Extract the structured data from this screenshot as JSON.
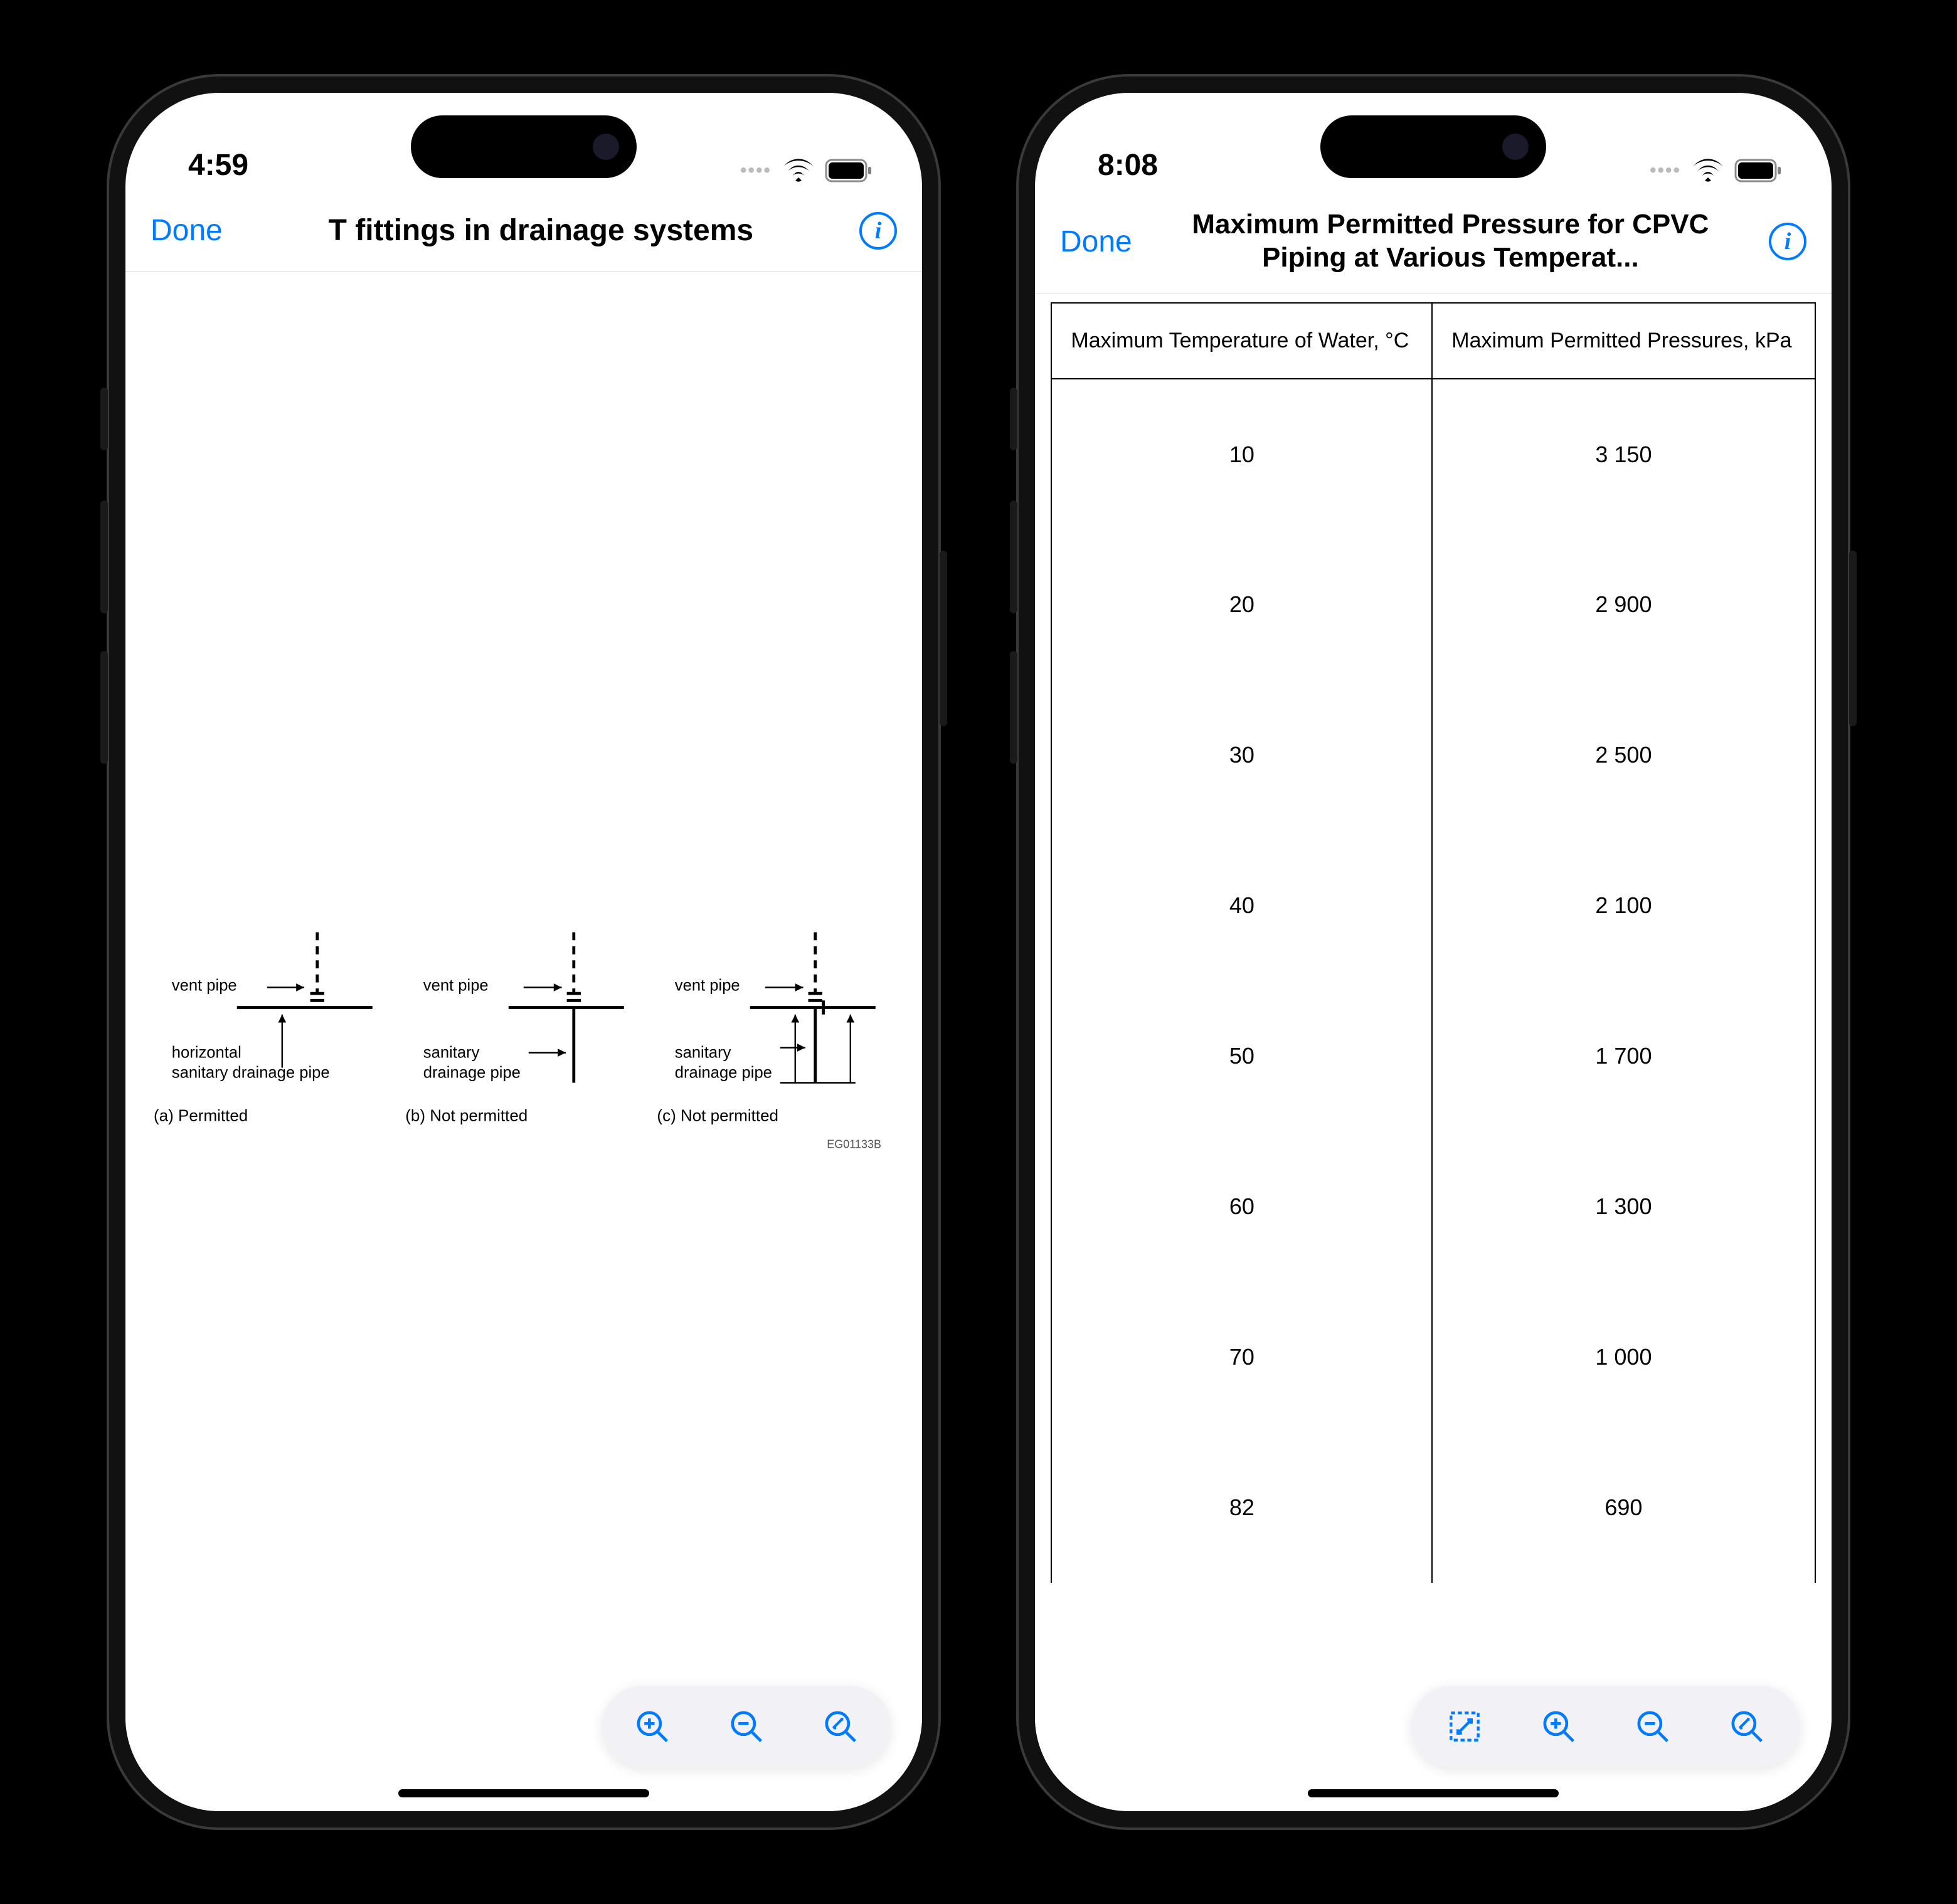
{
  "left": {
    "status": {
      "time": "4:59"
    },
    "nav": {
      "done": "Done",
      "title": "T fittings in drainage systems"
    },
    "diagram": {
      "a": {
        "vent_label": "vent pipe",
        "pipe_label1": "horizontal",
        "pipe_label2": "sanitary drainage pipe",
        "caption": "(a)  Permitted"
      },
      "b": {
        "vent_label": "vent pipe",
        "pipe_label1": "sanitary",
        "pipe_label2": "drainage pipe",
        "caption": "(b)  Not permitted"
      },
      "c": {
        "vent_label": "vent pipe",
        "pipe_label1": "sanitary",
        "pipe_label2": "drainage pipe",
        "caption": "(c)  Not permitted"
      },
      "code": "EG01133B"
    }
  },
  "right": {
    "status": {
      "time": "8:08"
    },
    "nav": {
      "done": "Done",
      "title": "Maximum Permitted Pressure for CPVC Piping at Various Temperat..."
    },
    "table": {
      "header1": "Maximum Temperature of Water, °C",
      "header2": "Maximum Permitted Pressures, kPa",
      "rows": [
        {
          "t": "10",
          "p": "3 150"
        },
        {
          "t": "20",
          "p": "2 900"
        },
        {
          "t": "30",
          "p": "2 500"
        },
        {
          "t": "40",
          "p": "2 100"
        },
        {
          "t": "50",
          "p": "1 700"
        },
        {
          "t": "60",
          "p": "1 300"
        },
        {
          "t": "70",
          "p": "1 000"
        },
        {
          "t": "82",
          "p": "690"
        }
      ]
    }
  },
  "chart_data": {
    "type": "table",
    "title": "Maximum Permitted Pressure for CPVC Piping at Various Temperatures",
    "columns": [
      "Maximum Temperature of Water, °C",
      "Maximum Permitted Pressures, kPa"
    ],
    "rows": [
      [
        10,
        3150
      ],
      [
        20,
        2900
      ],
      [
        30,
        2500
      ],
      [
        40,
        2100
      ],
      [
        50,
        1700
      ],
      [
        60,
        1300
      ],
      [
        70,
        1000
      ],
      [
        82,
        690
      ]
    ]
  }
}
